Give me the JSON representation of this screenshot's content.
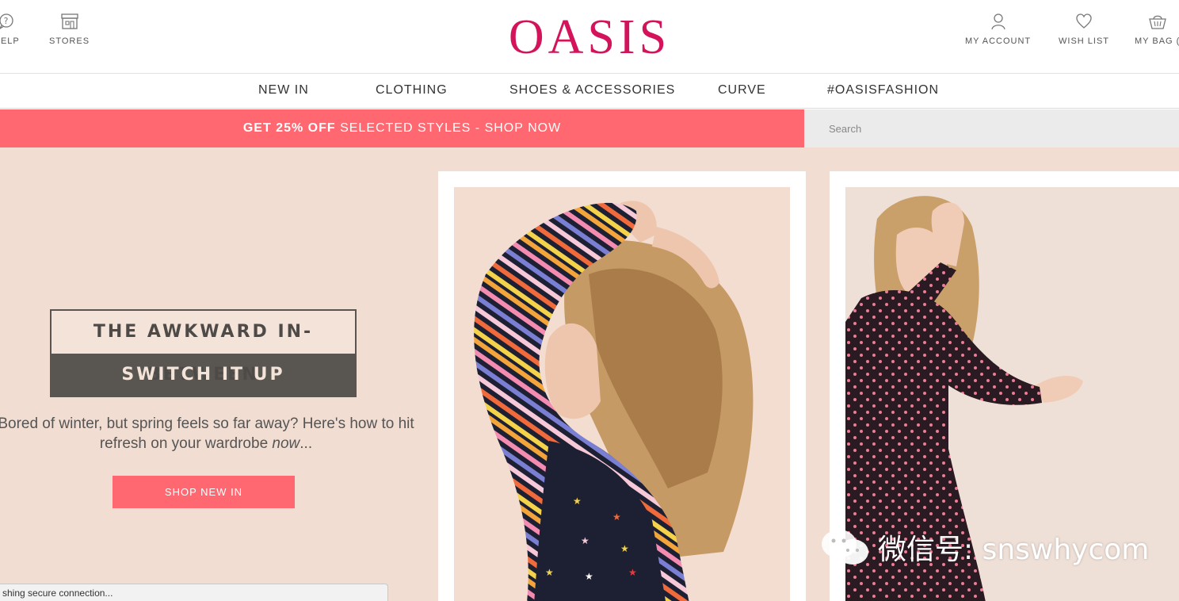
{
  "header": {
    "logo": "OASIS",
    "help_label": "HELP",
    "stores_label": "STORES",
    "account_label": "MY ACCOUNT",
    "wishlist_label": "WISH LIST",
    "bag_label": "MY BAG ("
  },
  "nav": {
    "items": [
      "NEW IN",
      "CLOTHING",
      "SHOES & ACCESSORIES",
      "CURVE",
      "#OASISFASHION"
    ]
  },
  "promo": {
    "bold": "GET 25% OFF",
    "rest": " SELECTED STYLES - SHOP NOW"
  },
  "search": {
    "placeholder": "Search"
  },
  "hero": {
    "title_line1": "THE AWKWARD IN-BETWEEN",
    "title_line2": "SWITCH IT UP",
    "tagline_main": "Bored of winter, but spring feels so far away? Here's how to hit refresh on your wardrobe ",
    "tagline_em": "now",
    "tagline_end": "...",
    "cta_label": "SHOP NEW IN"
  },
  "watermark": {
    "text": "微信号: snswhycom"
  },
  "status": {
    "text": "shing secure connection..."
  },
  "colors": {
    "brand": "#d4145a",
    "promo": "#ff6870",
    "hero_bg": "#f1ddd1",
    "title_dark": "#595652"
  }
}
